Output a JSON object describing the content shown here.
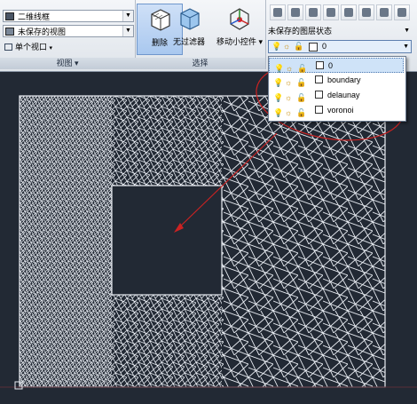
{
  "view_panel": {
    "visual_style": "二维线框",
    "saved_view": "未保存的视图",
    "viewport_config": "单个视口",
    "title": "视图"
  },
  "select_panel": {
    "buttons": [
      {
        "label": "删除",
        "icon": "delete-cube-icon",
        "active": true
      },
      {
        "label": "无过滤器",
        "icon": "filter-cube-icon",
        "active": false
      },
      {
        "label": "移动小控件",
        "icon": "move-gizmo-icon",
        "active": false
      }
    ],
    "title": "选择"
  },
  "layers_panel": {
    "layer_state": "未保存的图层状态",
    "current_layer": "0",
    "tool_icons": [
      "layer-properties-icon",
      "layer-state-icon",
      "match-layer-icon",
      "layer-previous-icon",
      "isolate-layer-icon",
      "unisolate-layer-icon",
      "freeze-layer-icon",
      "off-layer-icon"
    ]
  },
  "layer_dropdown": {
    "layers": [
      {
        "name": "0",
        "color": "#ffffff",
        "selected": true
      },
      {
        "name": "boundary",
        "color": "#ffffff",
        "selected": false
      },
      {
        "name": "delaunay",
        "color": "#ffffff",
        "selected": false
      },
      {
        "name": "voronoi",
        "color": "#ffffff",
        "selected": false
      }
    ]
  },
  "colors": {
    "canvas_bg": "#222934",
    "mesh_line": "#e8ecf2",
    "annotation": "#cc2222"
  }
}
